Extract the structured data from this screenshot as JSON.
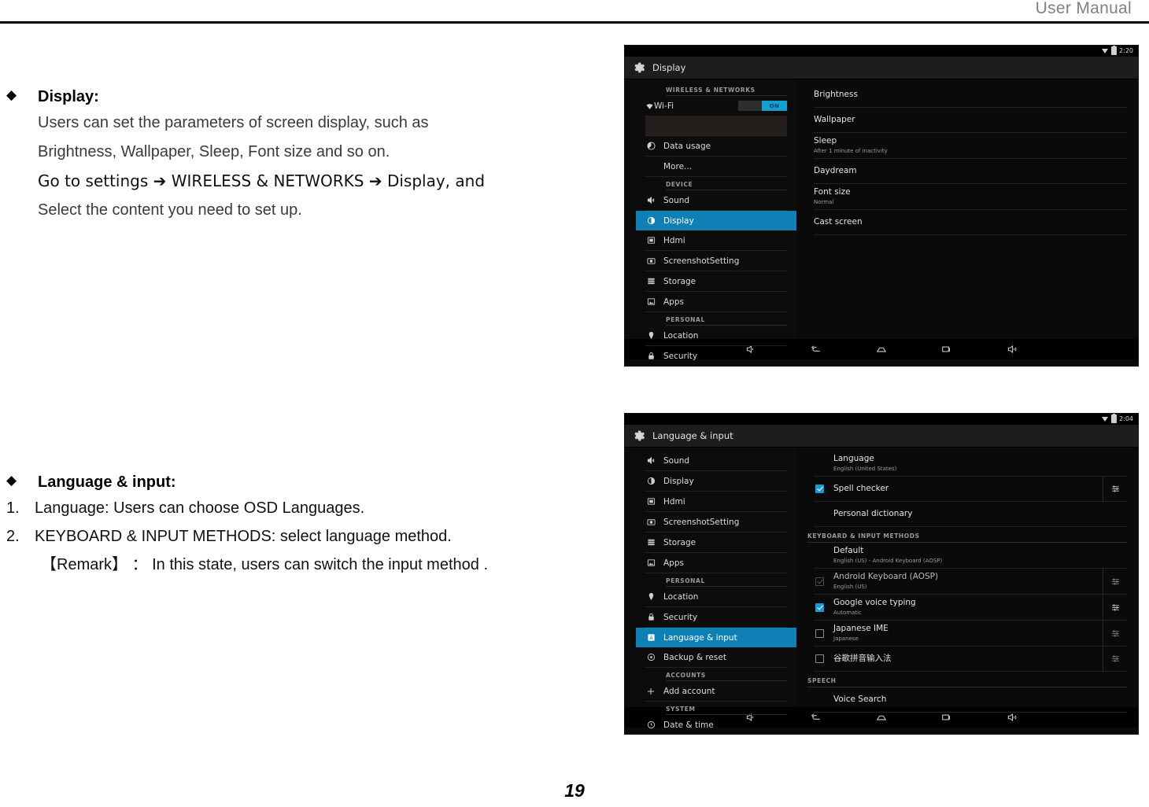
{
  "header": {
    "title": "User Manual"
  },
  "page": {
    "number": "19"
  },
  "sections": [
    {
      "bullet": "◆",
      "title": "Display:",
      "lines": [
        "Users can set the parameters of screen display, such as",
        "Brightness, Wallpaper, Sleep, Font size and so on.",
        "Go to settings ➔ WIRELESS & NETWORKS ➔ Display, and",
        "Select the content you need to set up."
      ]
    },
    {
      "bullet": "◆",
      "title": "Language & input:",
      "items": [
        {
          "num": "1.",
          "text": "Language: Users can choose OSD Languages."
        },
        {
          "num": "2.",
          "text": "KEYBOARD & INPUT METHODS: select language method."
        }
      ],
      "remark": "【Remark】 ： In this state, users can switch the input method ."
    }
  ],
  "accent": {
    "highlight_blue": "#0f80b5",
    "toggle_blue": "#149fd4",
    "check_blue": "#1a9bd7"
  },
  "screenshot_display": {
    "status": {
      "time": "2:20",
      "wifi_icon": "wifi-icon",
      "battery_icon": "battery-icon"
    },
    "actionbar": {
      "icon": "settings-gear-icon",
      "title": "Display"
    },
    "sidebar": [
      {
        "type": "header",
        "label": "WIRELESS & NETWORKS"
      },
      {
        "type": "toggle",
        "label": "Wi-Fi",
        "icon": "wifi-icon",
        "state": "ON"
      },
      {
        "type": "darkbox",
        "label": ""
      },
      {
        "type": "item",
        "label": "Data usage",
        "icon": "data-usage-icon"
      },
      {
        "type": "item-noicon",
        "label": "More...",
        "icon": ""
      },
      {
        "type": "header",
        "label": "DEVICE"
      },
      {
        "type": "item",
        "label": "Sound",
        "icon": "sound-icon"
      },
      {
        "type": "item",
        "label": "Display",
        "icon": "display-icon",
        "selected": true
      },
      {
        "type": "item",
        "label": "Hdmi",
        "icon": "hdmi-icon"
      },
      {
        "type": "item",
        "label": "ScreenshotSetting",
        "icon": "camera-icon"
      },
      {
        "type": "item",
        "label": "Storage",
        "icon": "storage-icon"
      },
      {
        "type": "item",
        "label": "Apps",
        "icon": "apps-icon"
      },
      {
        "type": "header",
        "label": "PERSONAL"
      },
      {
        "type": "item",
        "label": "Location",
        "icon": "location-pin-icon"
      },
      {
        "type": "item",
        "label": "Security",
        "icon": "lock-icon"
      }
    ],
    "content": [
      {
        "title": "Brightness",
        "sub": ""
      },
      {
        "title": "Wallpaper",
        "sub": ""
      },
      {
        "title": "Sleep",
        "sub": "After 1 minute of inactivity"
      },
      {
        "title": "Daydream",
        "sub": ""
      },
      {
        "title": "Font size",
        "sub": "Normal"
      },
      {
        "title": "Cast screen",
        "sub": ""
      }
    ],
    "navbar": [
      "volume-down-icon",
      "back-icon",
      "home-icon",
      "recents-icon",
      "volume-up-icon"
    ]
  },
  "screenshot_language": {
    "status": {
      "time": "2:04",
      "wifi_icon": "wifi-icon",
      "battery_icon": "battery-icon"
    },
    "actionbar": {
      "icon": "settings-gear-icon",
      "title": "Language & input"
    },
    "sidebar": [
      {
        "type": "item",
        "label": "Sound",
        "icon": "sound-icon"
      },
      {
        "type": "item",
        "label": "Display",
        "icon": "display-icon"
      },
      {
        "type": "item",
        "label": "Hdmi",
        "icon": "hdmi-icon"
      },
      {
        "type": "item",
        "label": "ScreenshotSetting",
        "icon": "camera-icon"
      },
      {
        "type": "item",
        "label": "Storage",
        "icon": "storage-icon"
      },
      {
        "type": "item",
        "label": "Apps",
        "icon": "apps-icon"
      },
      {
        "type": "header",
        "label": "PERSONAL"
      },
      {
        "type": "item",
        "label": "Location",
        "icon": "location-pin-icon"
      },
      {
        "type": "item",
        "label": "Security",
        "icon": "lock-icon"
      },
      {
        "type": "item",
        "label": "Language & input",
        "icon": "language-icon",
        "selected": true
      },
      {
        "type": "item",
        "label": "Backup & reset",
        "icon": "backup-reset-icon"
      },
      {
        "type": "header",
        "label": "ACCOUNTS"
      },
      {
        "type": "item",
        "label": "Add account",
        "icon": "plus-icon"
      },
      {
        "type": "header",
        "label": "SYSTEM"
      },
      {
        "type": "item",
        "label": "Date & time",
        "icon": "clock-icon"
      }
    ],
    "content": [
      {
        "kind": "plain",
        "title": "Language",
        "sub": "English (United States)"
      },
      {
        "kind": "check",
        "checked": "on",
        "title": "Spell checker",
        "sub": "",
        "sliders": true
      },
      {
        "kind": "plain",
        "title": "Personal dictionary",
        "sub": ""
      },
      {
        "kind": "section",
        "title": "KEYBOARD & INPUT METHODS"
      },
      {
        "kind": "plain",
        "title": "Default",
        "sub": "English (US) - Android Keyboard (AOSP)"
      },
      {
        "kind": "check",
        "checked": "dim",
        "title": "Android Keyboard (AOSP)",
        "sub": "English (US)",
        "sliders": true
      },
      {
        "kind": "check",
        "checked": "on",
        "title": "Google voice typing",
        "sub": "Automatic",
        "sliders": true
      },
      {
        "kind": "check",
        "checked": "off",
        "title": "Japanese IME",
        "sub": "Japanese",
        "sliders": true
      },
      {
        "kind": "check",
        "checked": "off",
        "title": "谷歌拼音输入法",
        "sub": "",
        "sliders": true
      },
      {
        "kind": "section",
        "title": "SPEECH"
      },
      {
        "kind": "plain",
        "title": "Voice Search",
        "sub": ""
      }
    ],
    "navbar": [
      "volume-down-icon",
      "back-icon",
      "home-icon",
      "recents-icon",
      "volume-up-icon"
    ]
  }
}
